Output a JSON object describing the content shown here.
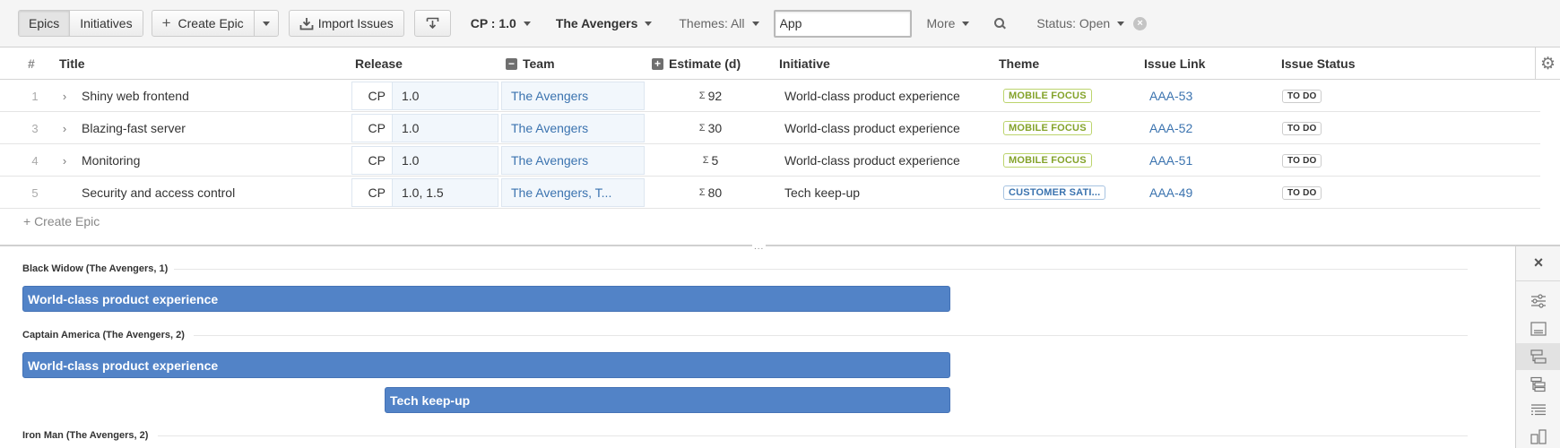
{
  "toolbar": {
    "view_tabs": [
      {
        "label": "Epics",
        "active": true
      },
      {
        "label": "Initiatives",
        "active": false
      }
    ],
    "create_epic_label": "Create Epic",
    "import_issues_label": "Import Issues",
    "filters": {
      "release": "CP : 1.0",
      "team": "The Avengers",
      "themes": "Themes: All",
      "more": "More",
      "status": "Status: Open"
    },
    "search_value": "App"
  },
  "table": {
    "headers": {
      "num": "#",
      "title": "Title",
      "release": "Release",
      "team": "Team",
      "estimate": "Estimate (d)",
      "initiative": "Initiative",
      "theme": "Theme",
      "issue_link": "Issue Link",
      "issue_status": "Issue Status"
    },
    "rows": [
      {
        "num": "1",
        "expandable": true,
        "title": "Shiny web frontend",
        "project": "CP",
        "release": "1.0",
        "team": "The Avengers",
        "sigma": "Σ",
        "estimate": "92",
        "initiative": "World-class product experience",
        "theme": "MOBILE FOCUS",
        "issue_link": "AAA-53",
        "status": "TO DO"
      },
      {
        "num": "3",
        "expandable": true,
        "title": "Blazing-fast server",
        "project": "CP",
        "release": "1.0",
        "team": "The Avengers",
        "sigma": "Σ",
        "estimate": "30",
        "initiative": "World-class product experience",
        "theme": "MOBILE FOCUS",
        "issue_link": "AAA-52",
        "status": "TO DO"
      },
      {
        "num": "4",
        "expandable": true,
        "title": "Monitoring",
        "project": "CP",
        "release": "1.0",
        "team": "The Avengers",
        "sigma": "Σ",
        "estimate": "5",
        "initiative": "World-class product experience",
        "theme": "MOBILE FOCUS",
        "issue_link": "AAA-51",
        "status": "TO DO"
      },
      {
        "num": "5",
        "expandable": false,
        "title": "Security and access control",
        "project": "CP",
        "release": "1.0, 1.5",
        "team": "The Avengers, T...",
        "sigma": "Σ",
        "estimate": "80",
        "initiative": "Tech keep-up",
        "theme": "CUSTOMER SATI...",
        "issue_link": "AAA-49",
        "status": "TO DO"
      }
    ],
    "create_epic_row": "+ Create Epic"
  },
  "splitter_grip": "...",
  "schedule": {
    "groups": [
      {
        "label": "Black Widow (The Avengers, 1)",
        "bars": [
          "World-class product experience"
        ]
      },
      {
        "label": "Captain America (The Avengers, 2)",
        "bars": [
          "World-class product experience",
          "Tech keep-up"
        ]
      },
      {
        "label": "Iron Man (The Avengers, 2)",
        "bars": []
      }
    ]
  },
  "side_panel": {
    "close": "×",
    "icons": [
      "sliders-icon",
      "card-icon",
      "hierarchy-icon",
      "tree-icon",
      "list-icon",
      "columns-icon"
    ]
  },
  "colors": {
    "bar": "#5283c7",
    "link": "#3b73af",
    "theme_green": "#84a32b",
    "theme_blue": "#3b73af"
  }
}
